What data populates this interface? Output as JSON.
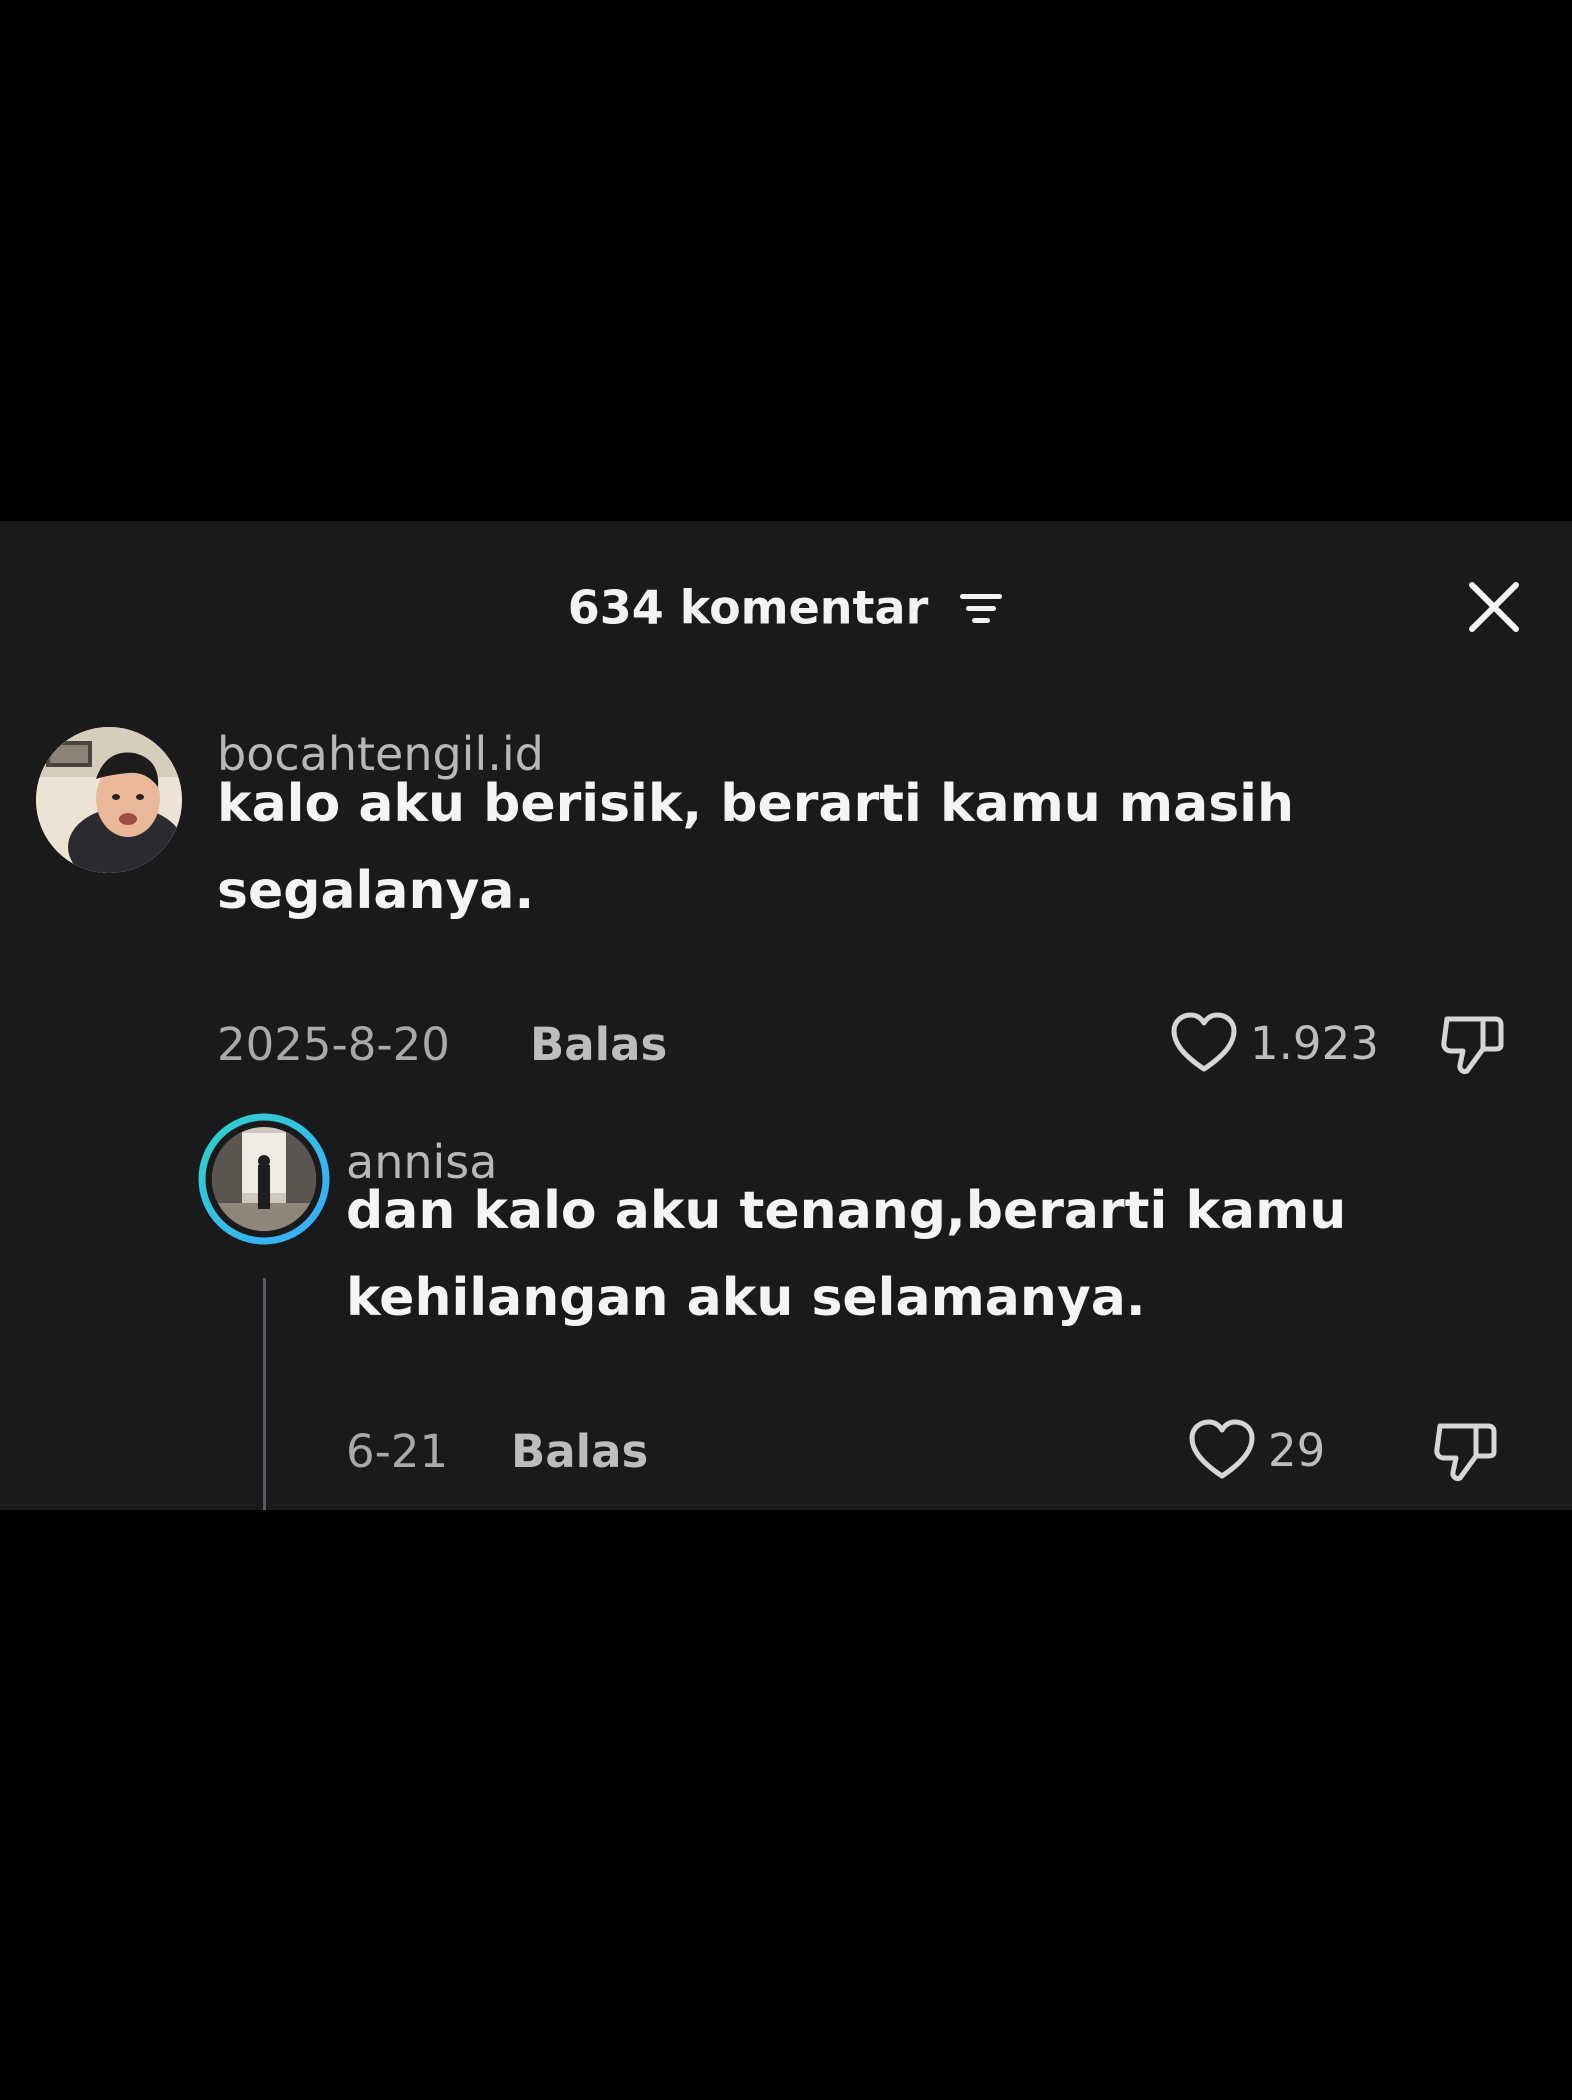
{
  "header": {
    "title": "634 komentar",
    "filter_icon": "filter-lines-icon",
    "close_icon": "close-icon"
  },
  "comments": [
    {
      "username": "bocahtengil.id",
      "text_lines": [
        "kalo aku berisik, berarti kamu masih",
        "segalanya."
      ],
      "date": "2025-8-20",
      "reply_label": "Balas",
      "likes": "1.923",
      "avatar": "user-photo-avatar"
    }
  ],
  "replies": [
    {
      "username": "annisa",
      "text_lines": [
        "dan kalo aku tenang,berarti kamu",
        "kehilangan aku selamanya."
      ],
      "date": "6-21",
      "reply_label": "Balas",
      "likes": "29",
      "avatar": "story-ring-avatar",
      "avatar_ring_colors": [
        "#2fd3c9",
        "#3aa9ff"
      ]
    }
  ],
  "colors": {
    "background": "#000000",
    "panel": "#1a1a1c",
    "text_primary": "#f4f4f4",
    "text_secondary": "#a9a9a9"
  }
}
